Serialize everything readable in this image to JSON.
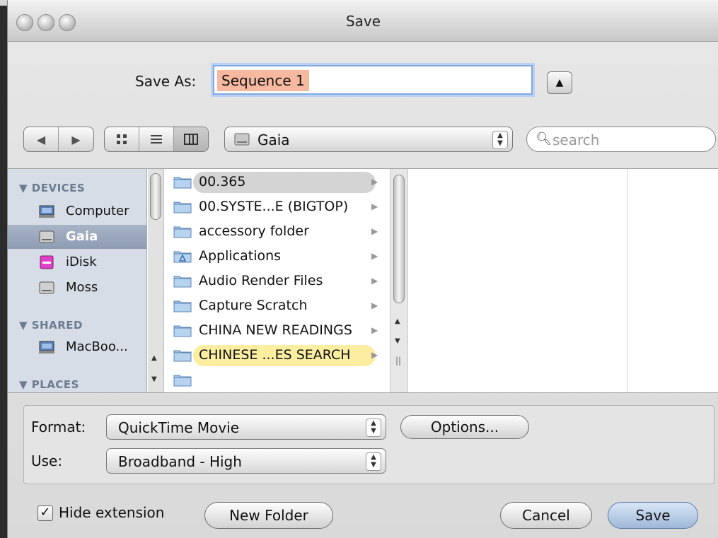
{
  "window": {
    "title": "Save"
  },
  "save_as": {
    "label": "Save As:",
    "value": "Sequence 1"
  },
  "toolbar": {
    "location": "Gaia",
    "search_placeholder": "search"
  },
  "sidebar": {
    "sections": [
      {
        "heading": "▼ DEVICES"
      },
      {
        "heading": "▼ SHARED"
      },
      {
        "heading": "▼ PLACES"
      }
    ],
    "items": [
      {
        "label": "Computer",
        "icon": "computer-icon",
        "selected": false
      },
      {
        "label": "Gaia",
        "icon": "hard-drive-icon",
        "selected": true
      },
      {
        "label": "iDisk",
        "icon": "idisk-icon",
        "selected": false
      },
      {
        "label": "Moss",
        "icon": "hard-drive-icon",
        "selected": false
      },
      {
        "label": "MacBoo...",
        "icon": "network-computer-icon",
        "selected": false
      }
    ]
  },
  "files": [
    {
      "name": "00.365",
      "icon": "folder-icon",
      "state": "selected"
    },
    {
      "name": "00.SYSTE...E (BIGTOP)",
      "icon": "folder-icon",
      "state": ""
    },
    {
      "name": "accessory folder",
      "icon": "folder-icon",
      "state": ""
    },
    {
      "name": "Applications",
      "icon": "applications-folder-icon",
      "state": ""
    },
    {
      "name": "Audio Render Files",
      "icon": "folder-icon",
      "state": ""
    },
    {
      "name": "Capture Scratch",
      "icon": "folder-icon",
      "state": ""
    },
    {
      "name": "CHINA NEW READINGS",
      "icon": "folder-icon",
      "state": ""
    },
    {
      "name": "CHINESE ...ES SEARCH",
      "icon": "folder-icon",
      "state": "highlighted"
    }
  ],
  "options": {
    "format_label": "Format:",
    "format_value": "QuickTime Movie",
    "use_label": "Use:",
    "use_value": "Broadband - High",
    "options_button": "Options..."
  },
  "footer": {
    "hide_extension_label": "Hide extension",
    "hide_extension_checked": true,
    "new_folder": "New Folder",
    "cancel": "Cancel",
    "save": "Save"
  },
  "colors": {
    "selection_orange": "#f7b8a0",
    "sidebar_bg": "#d7dde6",
    "highlight_yellow": "#fbeea0",
    "focus_blue": "#7ea8e6"
  }
}
